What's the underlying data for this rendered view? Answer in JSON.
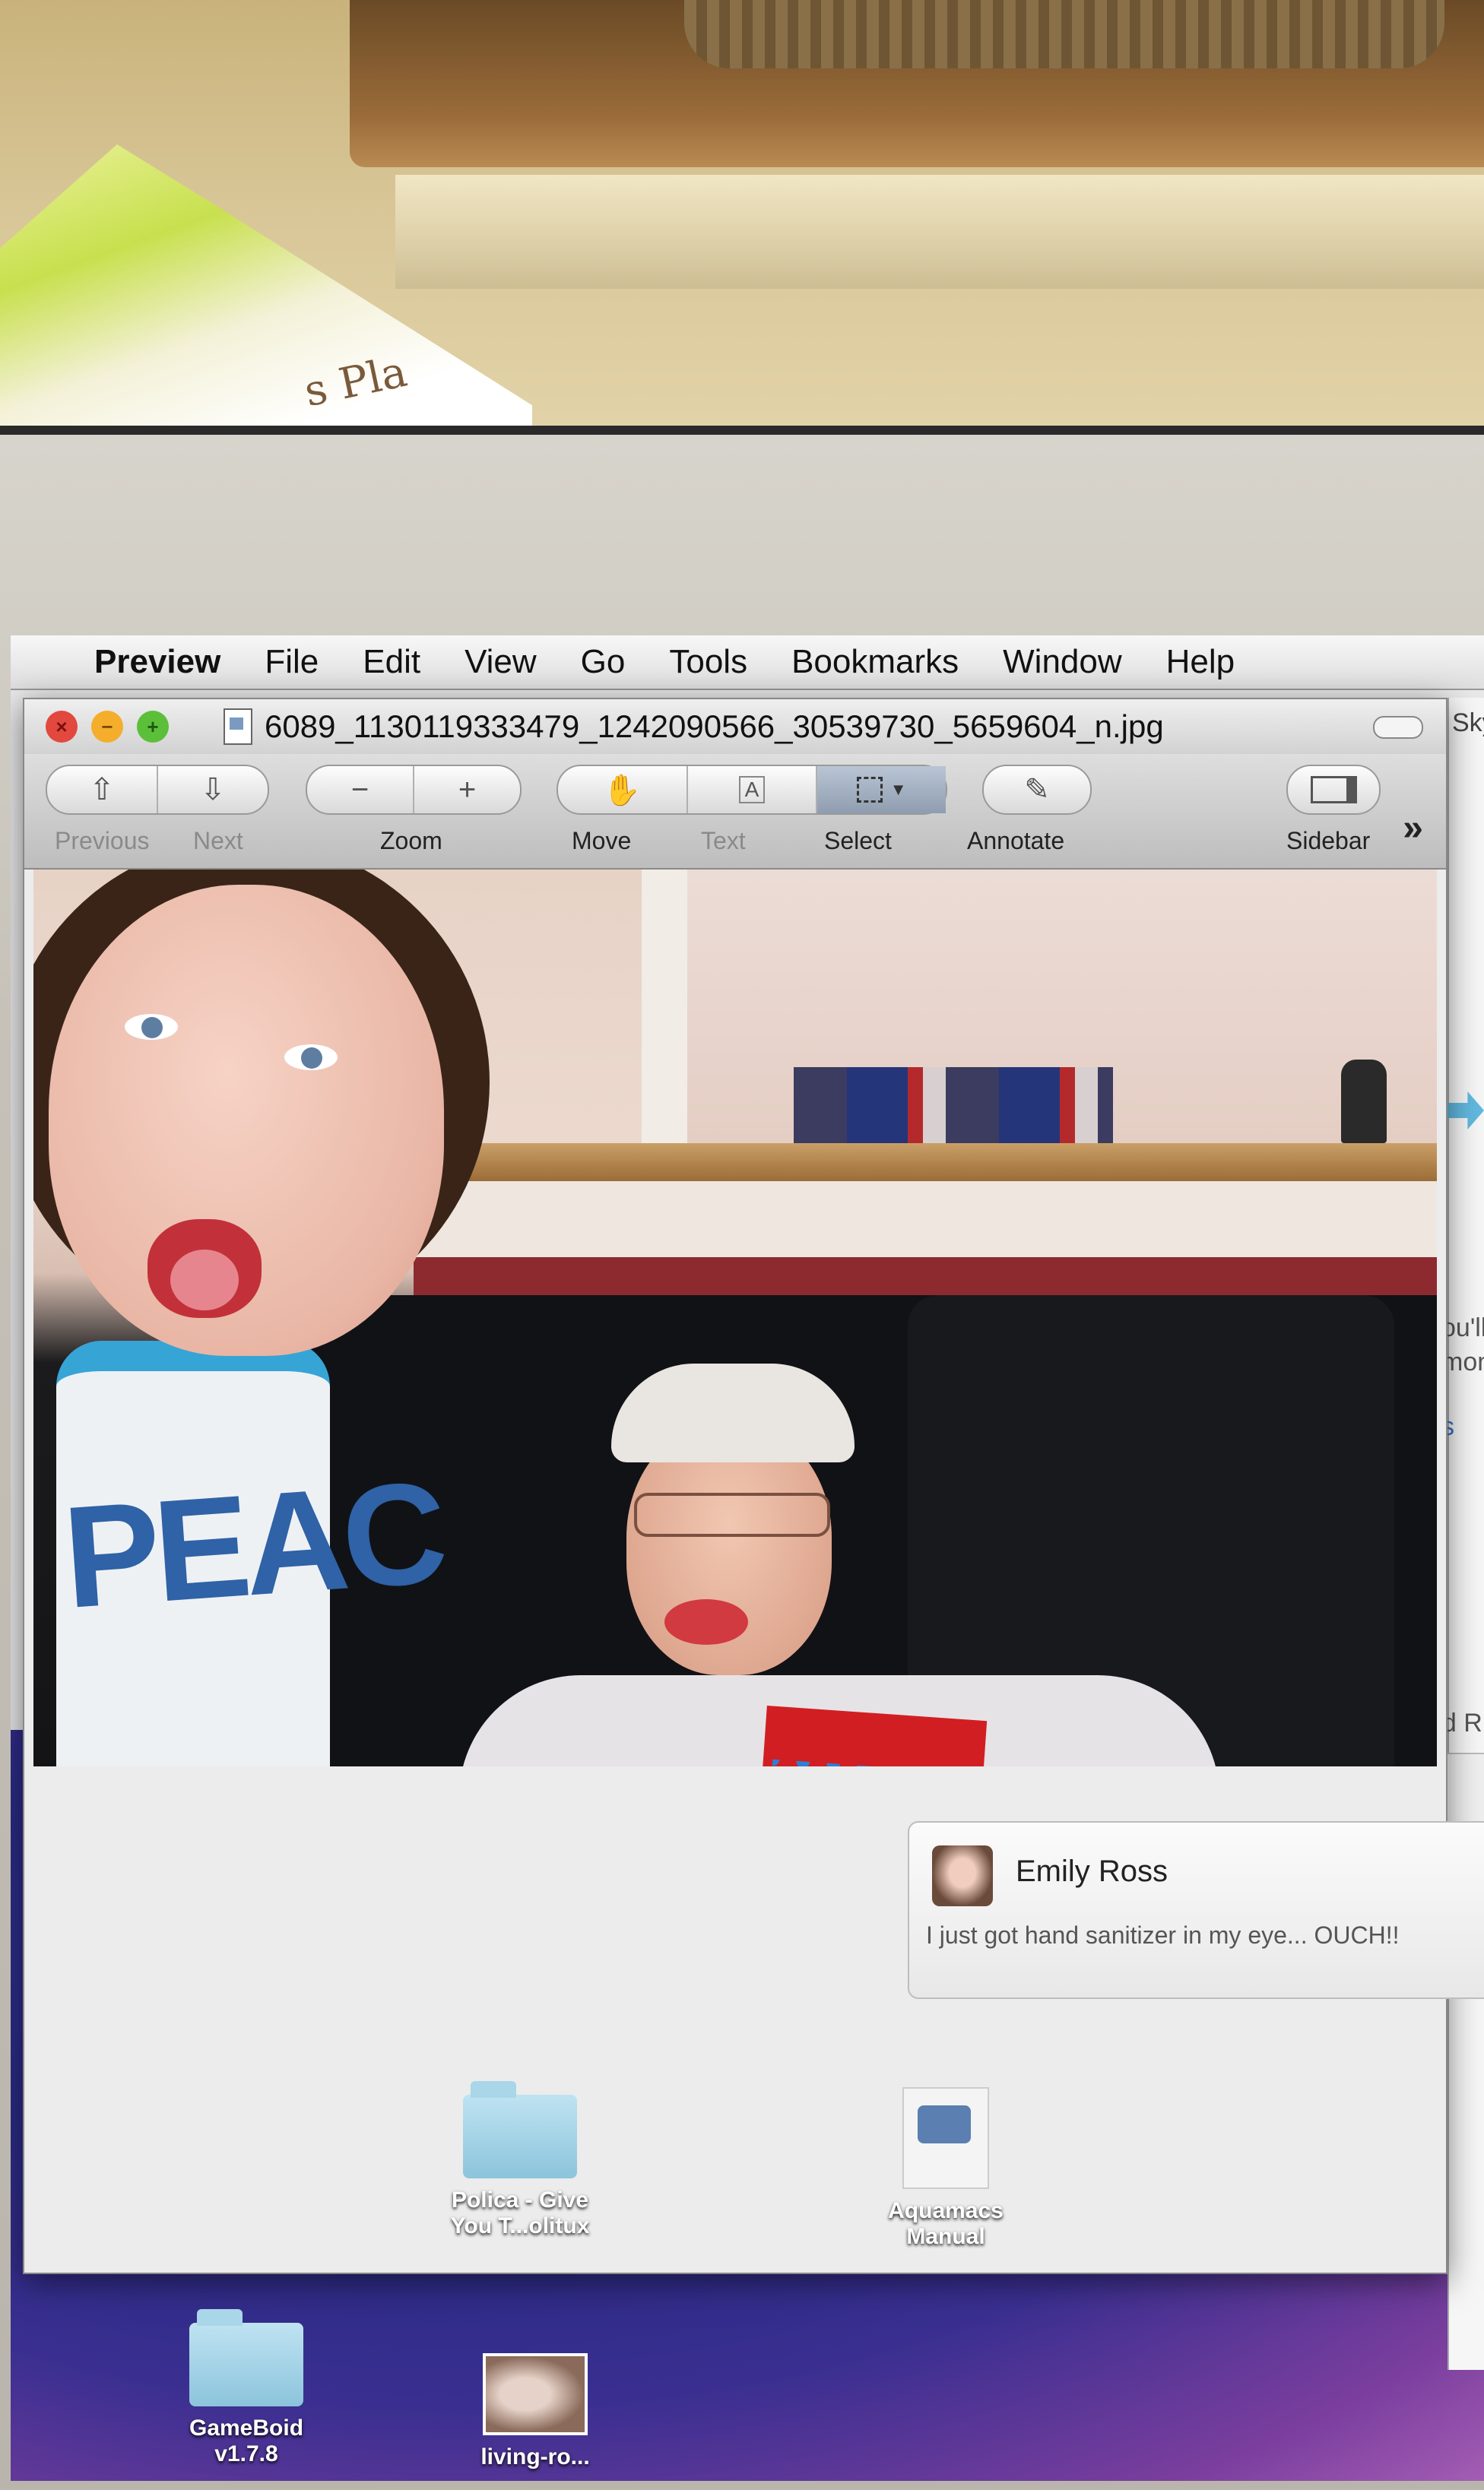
{
  "bag_text": "s Pla",
  "menubar": {
    "apple_icon": "",
    "app_name": "Preview",
    "items": [
      "File",
      "Edit",
      "View",
      "Go",
      "Tools",
      "Bookmarks",
      "Window",
      "Help"
    ]
  },
  "window": {
    "title": "6089_1130119333479_1242090566_30539730_5659604_n.jpg",
    "buttons": {
      "close": "×",
      "minimize": "−",
      "zoom": "+"
    }
  },
  "toolbar": {
    "previous_label": "Previous",
    "next_label": "Next",
    "zoom_label": "Zoom",
    "zoom_out": "−",
    "zoom_in": "+",
    "move_label": "Move",
    "text_label": "Text",
    "select_label": "Select",
    "annotate_label": "Annotate",
    "sidebar_label": "Sidebar",
    "more": "»"
  },
  "photo": {
    "shirt_text": "PEAC"
  },
  "background_window": {
    "line1": "ou'll get",
    "line2": "monthly",
    "line3": "s",
    "line4": "my friend R",
    "corner": "Sky"
  },
  "notification": {
    "name": "Emily Ross",
    "message": "I just got hand sanitizer in my eye... OUCH!!"
  },
  "desktop_icons": [
    {
      "label_line1": "Polica - Give",
      "label_line2": "You T...olitux"
    },
    {
      "label_line1": "Aquamacs",
      "label_line2": "Manual"
    },
    {
      "label_line1": "GameBoid",
      "label_line2": "v1.7.8"
    },
    {
      "label_line1": "living-ro..."
    }
  ],
  "colors": {
    "close": "#e2483e",
    "minimize": "#f4ae2b",
    "zoom": "#5bbf3a",
    "desktop_bg": "#2a2a85"
  },
  "icons": [
    "apple-icon",
    "document-icon",
    "arrow-up-icon",
    "arrow-down-icon",
    "hand-icon",
    "text-tool-icon",
    "select-tool-icon",
    "pencil-icon",
    "sidebar-icon",
    "folder-icon"
  ]
}
